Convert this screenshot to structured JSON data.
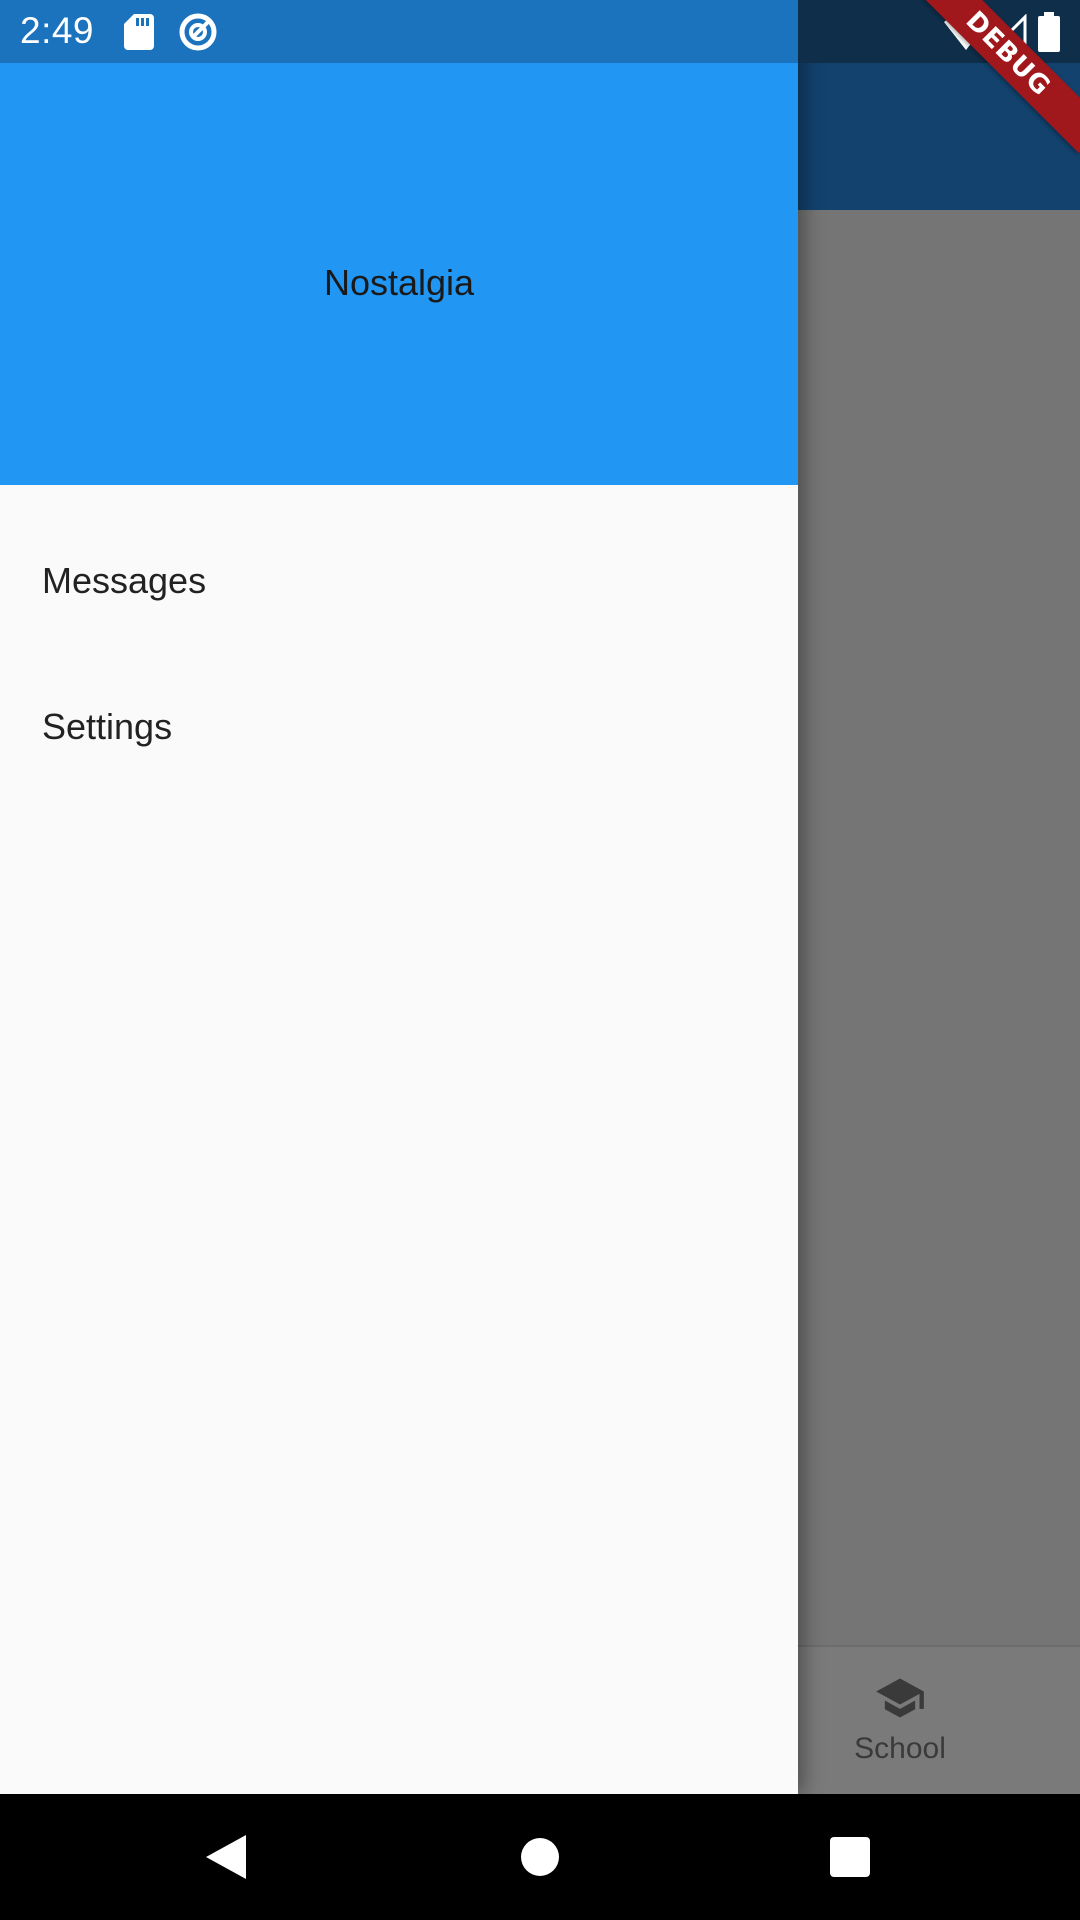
{
  "status_bar": {
    "time": "2:49",
    "left_icons": [
      "sd-card-icon",
      "data-saver-icon"
    ],
    "right_icons": [
      "wifi-icon",
      "cell-signal-icon",
      "battery-icon"
    ]
  },
  "debug_banner": {
    "label": "DEBUG",
    "color": "#a0171c"
  },
  "drawer": {
    "header": {
      "title": "Nostalgia",
      "color": "#2196f3"
    },
    "items": [
      {
        "label": "Messages"
      },
      {
        "label": "Settings"
      }
    ]
  },
  "background_app": {
    "bottom_nav": {
      "items": [
        {
          "label": "School",
          "icon": "school-icon"
        }
      ]
    }
  },
  "nav_bar": {
    "buttons": [
      "back-icon",
      "home-icon",
      "recents-icon"
    ]
  }
}
